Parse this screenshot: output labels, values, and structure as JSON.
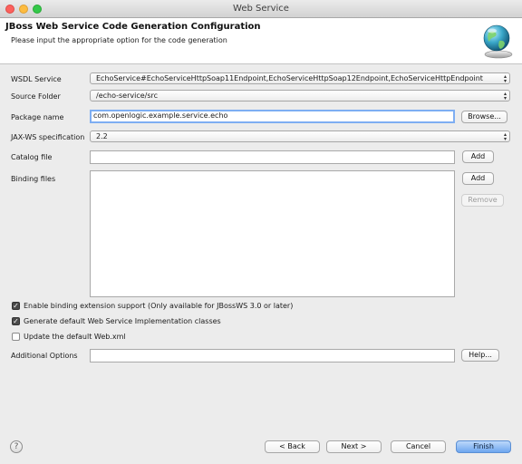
{
  "window": {
    "title": "Web Service"
  },
  "header": {
    "title": "JBoss Web Service Code Generation Configuration",
    "subtitle": "Please input the appropriate option for the code generation",
    "icon": "globe-icon"
  },
  "form": {
    "wsdl_service": {
      "label": "WSDL Service",
      "value": "EchoService#EchoServiceHttpSoap11Endpoint,EchoServiceHttpSoap12Endpoint,EchoServiceHttpEndpoint"
    },
    "source_folder": {
      "label": "Source Folder",
      "value": "/echo-service/src"
    },
    "package_name": {
      "label": "Package name",
      "value": "com.openlogic.example.service.echo",
      "browse_label": "Browse..."
    },
    "jaxws_spec": {
      "label": "JAX-WS specification",
      "value": "2.2"
    },
    "catalog_file": {
      "label": "Catalog file",
      "value": "",
      "add_label": "Add"
    },
    "binding_files": {
      "label": "Binding files",
      "add_label": "Add",
      "remove_label": "Remove"
    },
    "checkboxes": [
      {
        "label": "Enable binding extension support (Only available for JBossWS 3.0 or later)",
        "checked": true
      },
      {
        "label": "Generate default Web Service Implementation classes",
        "checked": true
      },
      {
        "label": "Update the default Web.xml",
        "checked": false
      }
    ],
    "additional_options": {
      "label": "Additional Options",
      "value": "",
      "help_label": "Help..."
    }
  },
  "footer": {
    "help_icon": "question-icon",
    "help_glyph": "?",
    "back_label": "< Back",
    "next_label": "Next >",
    "cancel_label": "Cancel",
    "finish_label": "Finish"
  }
}
